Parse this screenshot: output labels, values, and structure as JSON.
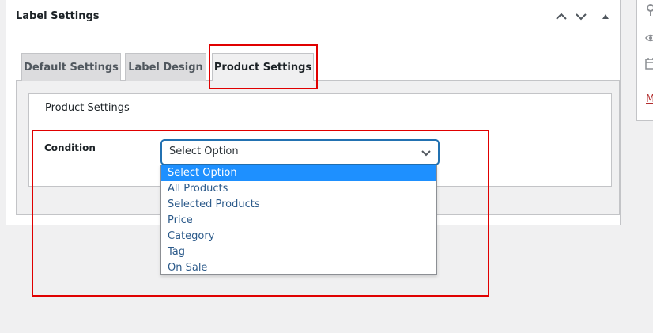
{
  "metabox": {
    "title": "Label Settings"
  },
  "tabs": [
    {
      "label": "Default Settings",
      "active": false
    },
    {
      "label": "Label Design",
      "active": false
    },
    {
      "label": "Product Settings",
      "active": true
    }
  ],
  "panel": {
    "title": "Product Settings",
    "condition_label": "Condition",
    "select_value": "Select Option",
    "options": [
      "Select Option",
      "All Products",
      "Selected Products",
      "Price",
      "Category",
      "Tag",
      "On Sale"
    ],
    "selected_index": 0
  },
  "sidebar": {
    "icons": [
      "pin-icon",
      "eye-icon",
      "calendar-icon"
    ],
    "link_fragment": "M"
  },
  "colors": {
    "highlight": "#e00000",
    "select_focus": "#2271b1",
    "option_selected_bg": "#1e90ff",
    "link_danger": "#b32d2e"
  }
}
